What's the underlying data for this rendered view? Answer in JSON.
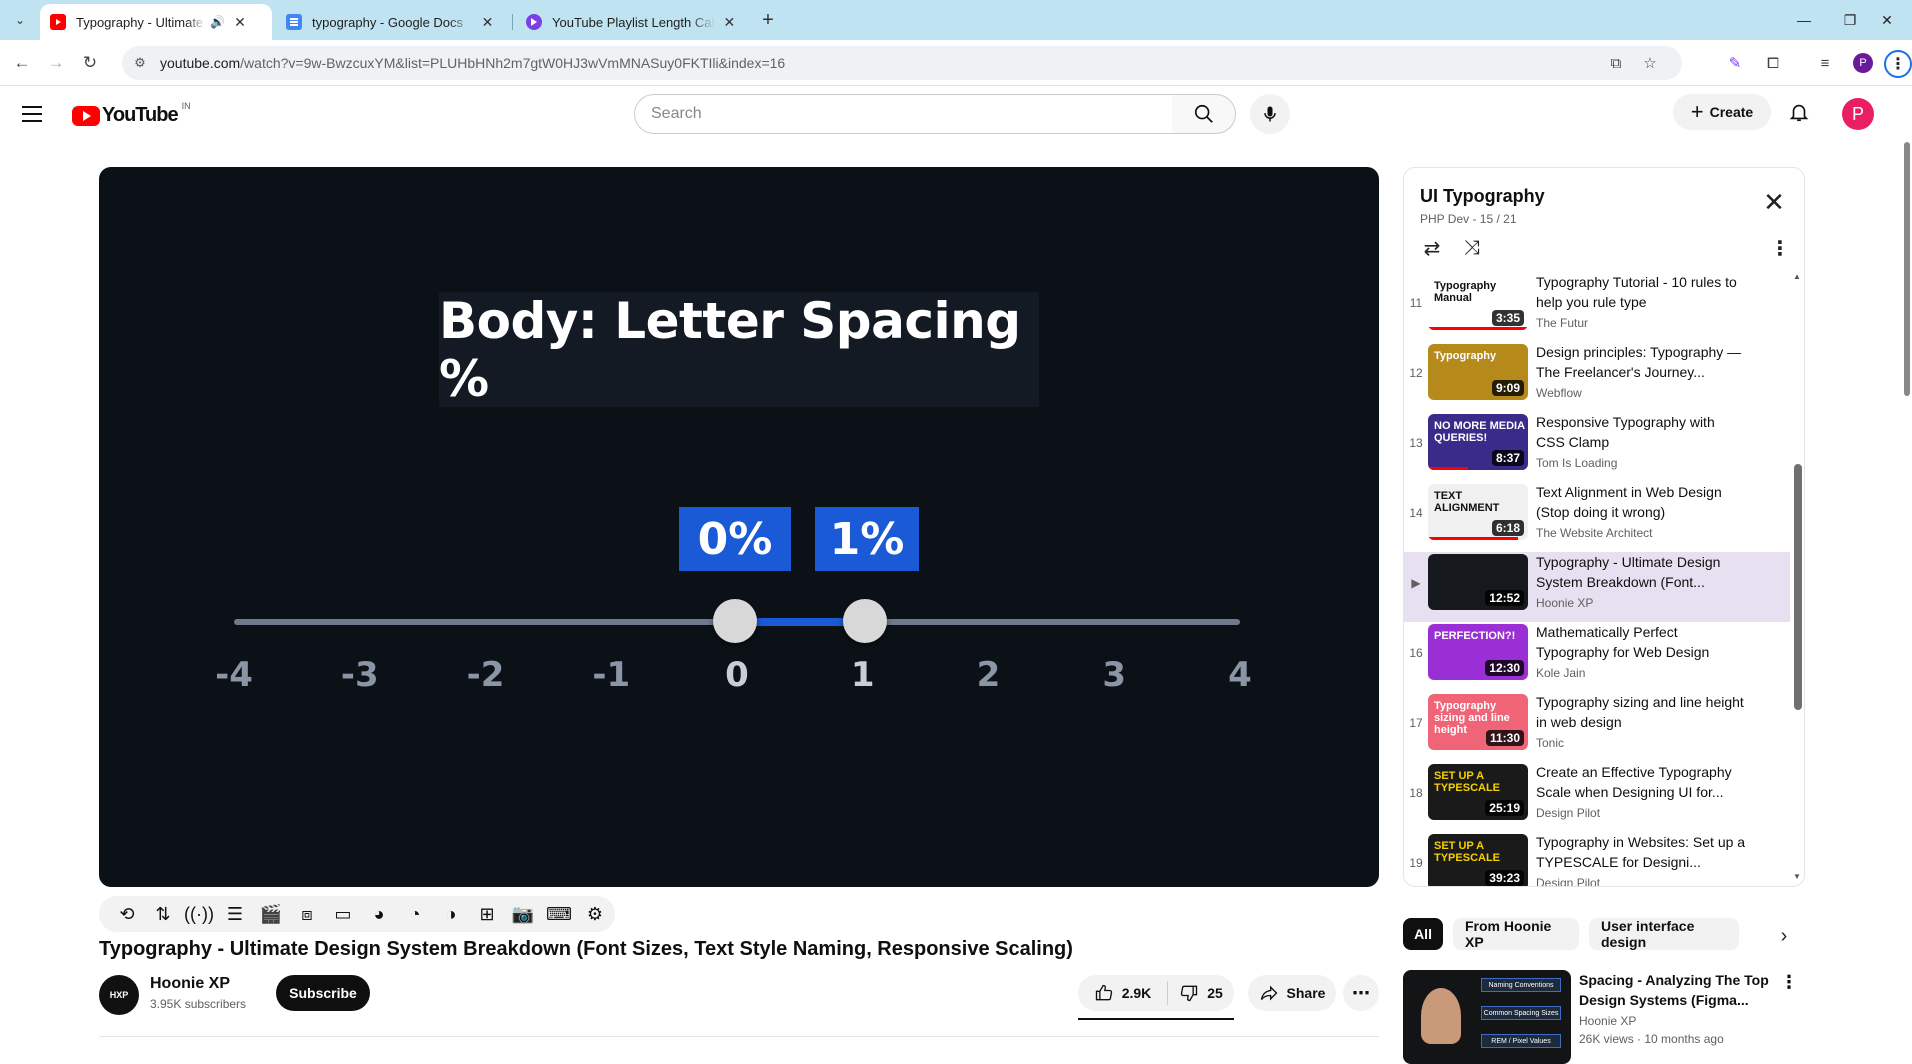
{
  "browser": {
    "tabs": [
      {
        "title": "Typography - Ultimate Design System Breakdown",
        "close": "✕",
        "active": true
      },
      {
        "title": "typography - Google Docs",
        "close": "✕",
        "active": false
      },
      {
        "title": "YouTube Playlist Length Calculator",
        "close": "✕",
        "active": false
      }
    ],
    "url_host": "youtube.com",
    "url_path": "/watch?v=9w-BwzcuxYM&list=PLUHbHNh2m7gtW0HJ3wVmMNASuy0FKTIli&index=16",
    "profile_initial": "P"
  },
  "masthead": {
    "logo_text": "YouTube",
    "country_code": "IN",
    "search_placeholder": "Search",
    "create_label": "Create",
    "avatar_initial": "P"
  },
  "player": {
    "slide_title": "Body: Letter Spacing %",
    "badges": [
      "0%",
      "1%"
    ],
    "ticks": [
      "-4",
      "-3",
      "-2",
      "-1",
      "0",
      "1",
      "2",
      "3",
      "4"
    ],
    "range_low": 0,
    "range_high": 1
  },
  "video": {
    "title": "Typography - Ultimate Design System Breakdown (Font Sizes, Text Style Naming, Responsive Scaling)",
    "channel": "Hoonie XP",
    "channel_avatar_text": "HXP",
    "subscribers": "3.95K subscribers",
    "subscribe_label": "Subscribe",
    "likes": "2.9K",
    "dislikes": "25",
    "share_label": "Share"
  },
  "playlist": {
    "title": "UI Typography",
    "subtitle": "PHP Dev - 15 / 21",
    "items": [
      {
        "index": "11",
        "title": "Typography Tutorial - 10 rules to help you rule type",
        "channel": "The Futur",
        "duration": "3:35",
        "thumb_text": "Typography Manual",
        "thumb_bg": "#ffffff",
        "thumb_fg": "#111111",
        "watched": 1.0
      },
      {
        "index": "12",
        "title": "Design principles: Typography — The Freelancer's Journey...",
        "channel": "Webflow",
        "duration": "9:09",
        "thumb_text": "Typography",
        "thumb_bg": "#b58a1a",
        "thumb_fg": "#ffffff",
        "watched": 0.0
      },
      {
        "index": "13",
        "title": "Responsive Typography with CSS Clamp",
        "channel": "Tom Is Loading",
        "duration": "8:37",
        "thumb_text": "NO MORE MEDIA QUERIES!",
        "thumb_bg": "#3a2a8a",
        "thumb_fg": "#ffffff",
        "watched": 0.4
      },
      {
        "index": "14",
        "title": "Text Alignment in Web Design (Stop doing it wrong)",
        "channel": "The Website Architect",
        "duration": "6:18",
        "thumb_text": "TEXT ALIGNMENT",
        "thumb_bg": "#f0f0f0",
        "thumb_fg": "#111111",
        "watched": 0.9
      },
      {
        "index": "▶",
        "title": "Typography - Ultimate Design System Breakdown (Font...",
        "channel": "Hoonie XP",
        "duration": "12:52",
        "thumb_text": "",
        "thumb_bg": "#15181c",
        "thumb_fg": "#ffffff",
        "watched": 0.0
      },
      {
        "index": "16",
        "title": "Mathematically Perfect Typography for Web Design",
        "channel": "Kole Jain",
        "duration": "12:30",
        "thumb_text": "PERFECTION?!",
        "thumb_bg": "#9b2fd6",
        "thumb_fg": "#ffffff",
        "watched": 0.0
      },
      {
        "index": "17",
        "title": "Typography sizing and line height in web design",
        "channel": "Tonic",
        "duration": "11:30",
        "thumb_text": "Typography sizing and line height",
        "thumb_bg": "#f06478",
        "thumb_fg": "#ffffff",
        "watched": 0.0
      },
      {
        "index": "18",
        "title": "Create an Effective Typography Scale when Designing UI for...",
        "channel": "Design Pilot",
        "duration": "25:19",
        "thumb_text": "SET UP A TYPESCALE",
        "thumb_bg": "#1a1a1a",
        "thumb_fg": "#f5d000",
        "watched": 0.0
      },
      {
        "index": "19",
        "title": "Typography in Websites: Set up a TYPESCALE for Designi...",
        "channel": "Design Pilot",
        "duration": "39:23",
        "thumb_text": "SET UP A TYPESCALE",
        "thumb_bg": "#1a1a1a",
        "thumb_fg": "#f5d000",
        "watched": 0.0
      }
    ]
  },
  "chips": [
    "All",
    "From Hoonie XP",
    "User interface design"
  ],
  "recommendation": {
    "title": "Spacing - Analyzing The Top Design Systems (Figma...",
    "channel": "Hoonie XP",
    "meta": "26K views · 10 months ago",
    "thumb_labels": [
      "Naming Conventions",
      "Common Spacing Sizes",
      "REM / Pixel Values"
    ]
  }
}
